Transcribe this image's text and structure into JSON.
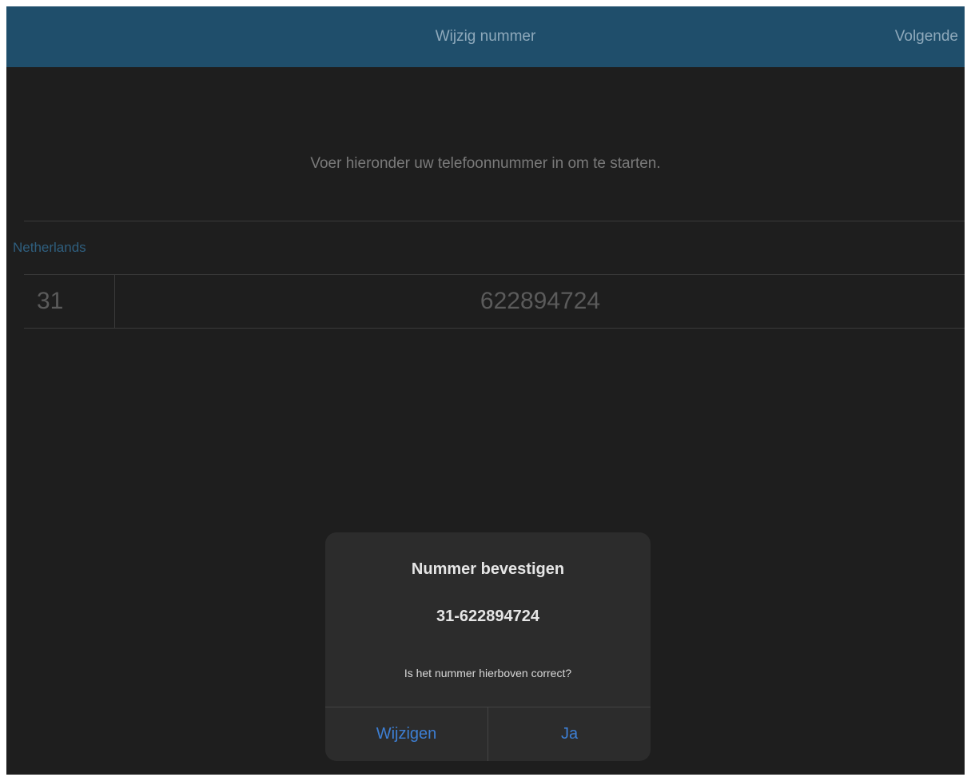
{
  "navbar": {
    "title": "Wijzig nummer",
    "next_label": "Volgende"
  },
  "form": {
    "instruction": "Voer hieronder uw telefoonnummer in om te starten.",
    "country": "Netherlands",
    "country_code": "31",
    "phone_number": "622894724"
  },
  "alert": {
    "title": "Nummer bevestigen",
    "number": "31-622894724",
    "message": "Is het nummer hierboven correct?",
    "buttons": [
      {
        "label": "Wijzigen"
      },
      {
        "label": "Ja"
      }
    ]
  },
  "colors": {
    "navbar": "#1f4e6b",
    "background": "#1e1e1e",
    "accent": "#3d7fd4",
    "country": "#2f5f7f"
  }
}
